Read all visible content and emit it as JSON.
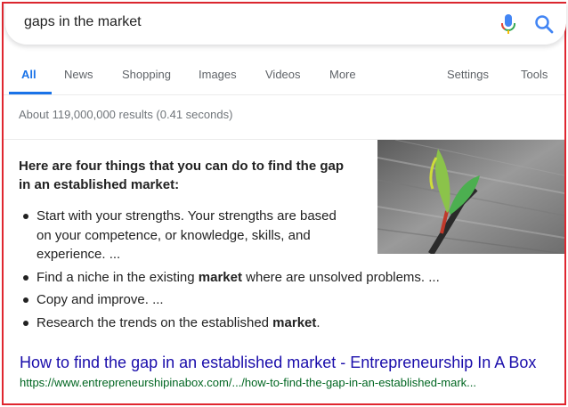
{
  "search": {
    "query": "gaps in the market"
  },
  "tabs": [
    {
      "label": "All"
    },
    {
      "label": "News"
    },
    {
      "label": "Shopping"
    },
    {
      "label": "Images"
    },
    {
      "label": "Videos"
    },
    {
      "label": "More"
    },
    {
      "label": "Settings"
    },
    {
      "label": "Tools"
    }
  ],
  "result_stats": "About 119,000,000 results (0.41 seconds)",
  "snippet": {
    "heading": "Here are four things that you can do to find the gap in an established market:",
    "items": [
      {
        "pre": "Start with your strengths. Your strengths are based on your competence, or knowledge, skills, and experience. ...",
        "bold": "",
        "post": ""
      },
      {
        "pre": "Find a niche in the existing ",
        "bold": "market",
        "post": " where are unsolved problems. ..."
      },
      {
        "pre": "Copy and improve. ...",
        "bold": "",
        "post": ""
      },
      {
        "pre": "Research the trends on the established ",
        "bold": "market",
        "post": "."
      }
    ]
  },
  "result": {
    "title": "How to find the gap in an established market - Entrepreneurship In A Box",
    "url": "https://www.entrepreneurshipinabox.com/.../how-to-find-the-gap-in-an-established-mark..."
  },
  "colors": {
    "accent": "#1a73e8",
    "link": "#1a0dab",
    "url": "#006621",
    "frame": "#e0262f"
  },
  "icons": [
    "mic-icon",
    "search-icon"
  ]
}
